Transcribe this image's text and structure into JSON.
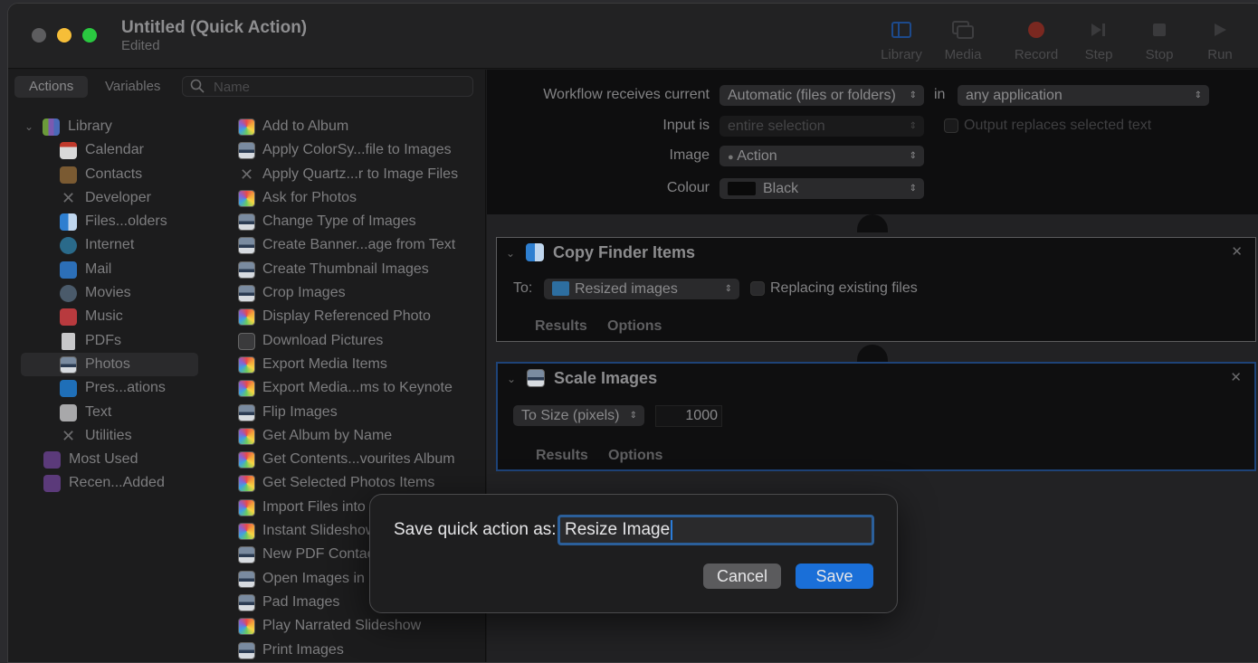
{
  "window": {
    "title": "Untitled (Quick Action)",
    "subtitle": "Edited"
  },
  "toolbar": {
    "buttons": [
      {
        "label": "Library",
        "icon": "sidebar-icon"
      },
      {
        "label": "Media",
        "icon": "photos-icon"
      },
      {
        "label": "Record",
        "icon": "record-icon"
      },
      {
        "label": "Step",
        "icon": "step-icon"
      },
      {
        "label": "Stop",
        "icon": "stop-icon"
      },
      {
        "label": "Run",
        "icon": "play-icon"
      }
    ]
  },
  "left_pane": {
    "tabs": [
      {
        "label": "Actions",
        "active": true
      },
      {
        "label": "Variables",
        "active": false
      }
    ],
    "search": {
      "placeholder": "Name",
      "value": ""
    },
    "library": {
      "root_label": "Library",
      "items": [
        {
          "label": "Calendar",
          "icon": "calendar-icon"
        },
        {
          "label": "Contacts",
          "icon": "contacts-icon"
        },
        {
          "label": "Developer",
          "icon": "developer-tools-icon"
        },
        {
          "label": "Files...olders",
          "icon": "finder-icon"
        },
        {
          "label": "Internet",
          "icon": "globe-icon"
        },
        {
          "label": "Mail",
          "icon": "mail-icon"
        },
        {
          "label": "Movies",
          "icon": "quicktime-icon"
        },
        {
          "label": "Music",
          "icon": "music-icon"
        },
        {
          "label": "PDFs",
          "icon": "pdf-icon"
        },
        {
          "label": "Photos",
          "icon": "photo-icon",
          "selected": true
        },
        {
          "label": "Pres...ations",
          "icon": "keynote-icon"
        },
        {
          "label": "Text",
          "icon": "text-icon"
        },
        {
          "label": "Utilities",
          "icon": "utilities-icon"
        }
      ],
      "smart_groups": [
        {
          "label": "Most Used",
          "icon": "smart-folder-icon"
        },
        {
          "label": "Recen...Added",
          "icon": "smart-folder-icon"
        }
      ]
    },
    "actions": [
      {
        "label": "Add to Album",
        "icon": "photos"
      },
      {
        "label": "Apply ColorSy...file to Images",
        "icon": "image"
      },
      {
        "label": "Apply Quartz...r to Image Files",
        "icon": "tools"
      },
      {
        "label": "Ask for Photos",
        "icon": "photos"
      },
      {
        "label": "Change Type of Images",
        "icon": "image"
      },
      {
        "label": "Create Banner...age from Text",
        "icon": "image"
      },
      {
        "label": "Create Thumbnail Images",
        "icon": "image"
      },
      {
        "label": "Crop Images",
        "icon": "image"
      },
      {
        "label": "Display Referenced Photo",
        "icon": "photos"
      },
      {
        "label": "Download Pictures",
        "icon": "camera"
      },
      {
        "label": "Export Media Items",
        "icon": "photos"
      },
      {
        "label": "Export Media...ms to Keynote",
        "icon": "photos"
      },
      {
        "label": "Flip Images",
        "icon": "image"
      },
      {
        "label": "Get Album by Name",
        "icon": "photos"
      },
      {
        "label": "Get Contents...vourites Album",
        "icon": "photos"
      },
      {
        "label": "Get Selected Photos Items",
        "icon": "photos"
      },
      {
        "label": "Import Files into",
        "icon": "photos"
      },
      {
        "label": "Instant Slideshow",
        "icon": "photos"
      },
      {
        "label": "New PDF Contac",
        "icon": "image"
      },
      {
        "label": "Open Images in",
        "icon": "image"
      },
      {
        "label": "Pad Images",
        "icon": "image"
      },
      {
        "label": "Play Narrated Slideshow",
        "icon": "photos"
      },
      {
        "label": "Print Images",
        "icon": "image"
      }
    ]
  },
  "workflow": {
    "receives_label": "Workflow receives current",
    "receives_value": "Automatic (files or folders)",
    "in_label": "in",
    "application_value": "any application",
    "input_is_label": "Input is",
    "input_is_value": "entire selection",
    "output_replaces_label": "Output replaces selected text",
    "image_label": "Image",
    "image_value": "Action",
    "colour_label": "Colour",
    "colour_value": "Black",
    "colour_swatch": "#0a0a0a"
  },
  "actions_in_workflow": [
    {
      "title": "Copy Finder Items",
      "to_label": "To:",
      "to_value": "Resized images",
      "replacing_label": "Replacing existing files",
      "tabs": [
        "Results",
        "Options"
      ]
    },
    {
      "title": "Scale Images",
      "mode_value": "To Size (pixels)",
      "size_value": "1000",
      "tabs": [
        "Results",
        "Options"
      ]
    }
  ],
  "dialog": {
    "label": "Save quick action as:",
    "value": "Resize Image",
    "cancel_label": "Cancel",
    "save_label": "Save"
  },
  "colors": {
    "accent": "#1a6fd8",
    "selection_border": "#1e4378",
    "record": "#8a2a22"
  }
}
